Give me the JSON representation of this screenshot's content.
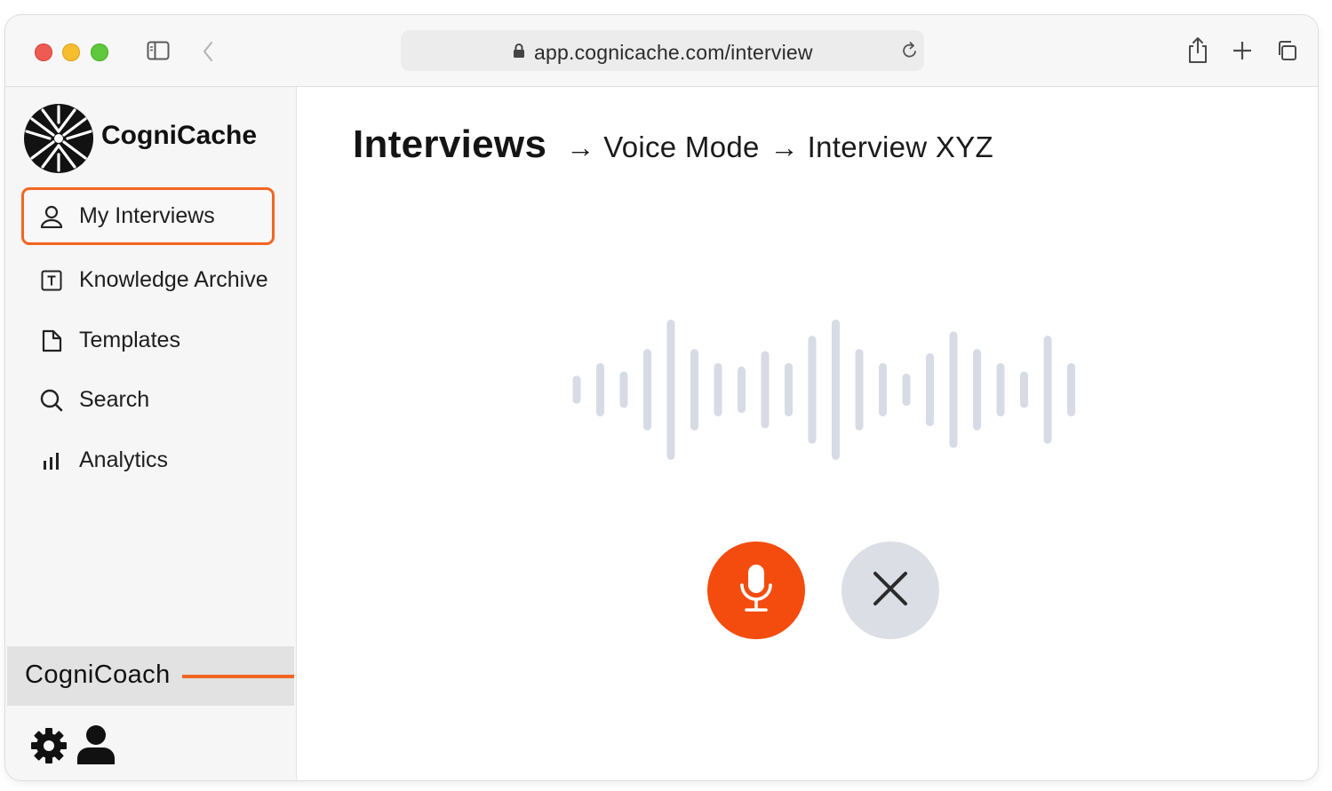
{
  "browser": {
    "url": "app.cognicache.com/interview",
    "icons": [
      "sidebar-toggle-icon",
      "back-chevron-icon",
      "lock-icon",
      "reload-icon",
      "share-icon",
      "plus-icon",
      "tabs-icon"
    ]
  },
  "sidebar": {
    "brand": "CogniCache",
    "items": [
      {
        "label": "My Interviews",
        "icon": "user-icon",
        "active": true
      },
      {
        "label": "Knowledge Archive",
        "icon": "text-box-icon",
        "active": false
      },
      {
        "label": "Templates",
        "icon": "document-icon",
        "active": false
      },
      {
        "label": "Search",
        "icon": "search-icon",
        "active": false
      },
      {
        "label": "Analytics",
        "icon": "bar-chart-icon",
        "active": false
      }
    ],
    "coach_label": "CogniCoach",
    "bottom_icons": [
      "gear-icon",
      "profile-icon"
    ]
  },
  "main": {
    "breadcrumb": {
      "root": "Interviews",
      "separator": "→",
      "mode": "Voice Mode",
      "current": "Interview XYZ"
    },
    "waveform": {
      "bar_levels": [
        0.2,
        0.38,
        0.26,
        0.58,
        1.0,
        0.58,
        0.38,
        0.33,
        0.55,
        0.38,
        0.77,
        1.0,
        0.58,
        0.38,
        0.23,
        0.52,
        0.83,
        0.58,
        0.38,
        0.26,
        0.77,
        0.38
      ]
    },
    "controls": {
      "mic_icon": "microphone-icon",
      "close_icon": "close-icon"
    }
  },
  "colors": {
    "accent": "#f26522",
    "mic_button": "#f44c0e",
    "close_button": "#dcdee6",
    "wave_bars": "#d7dbe5"
  }
}
